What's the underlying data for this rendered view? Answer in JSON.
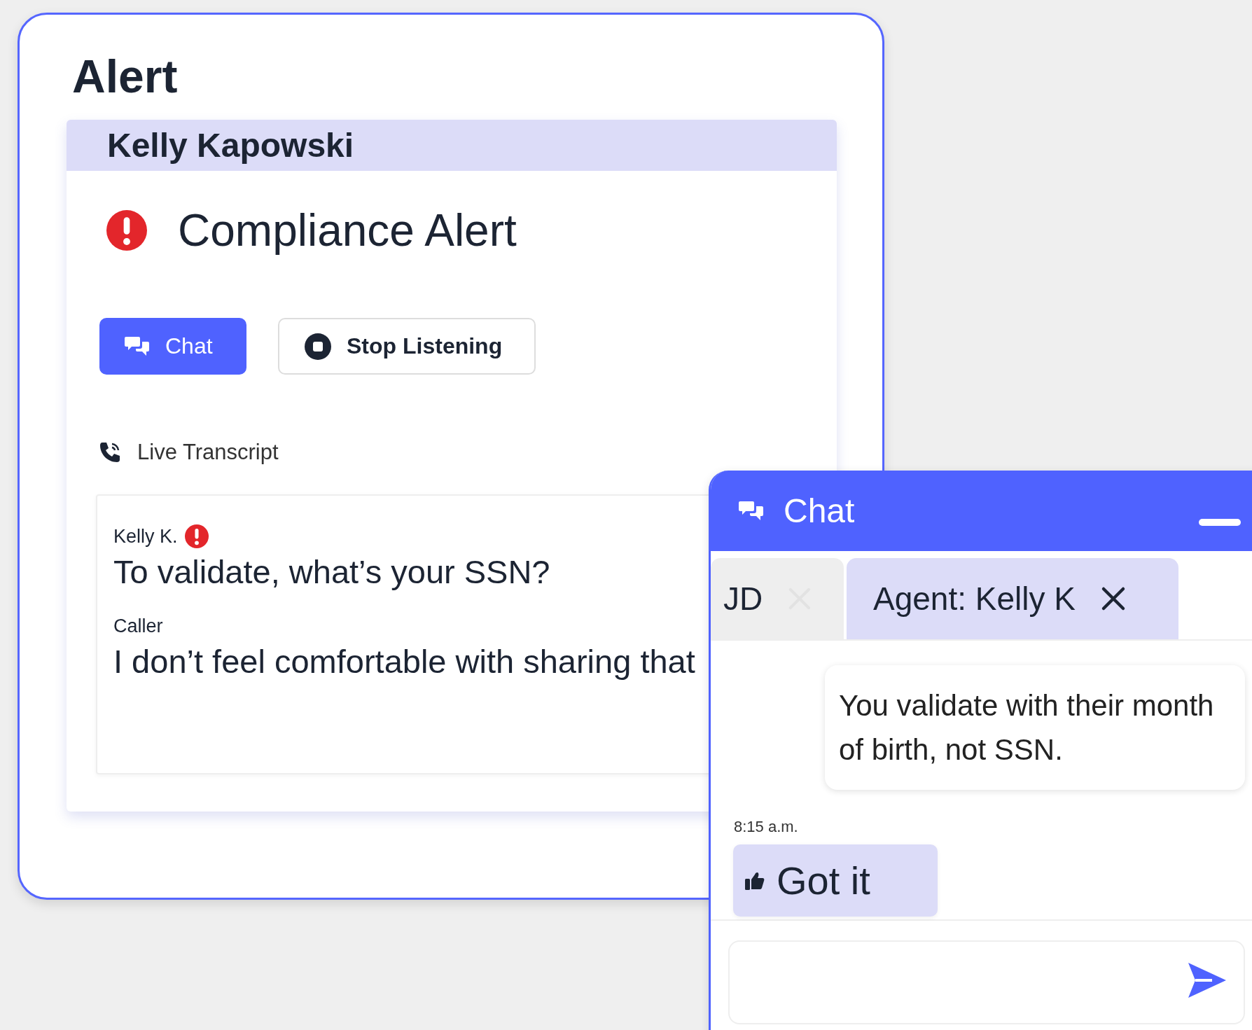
{
  "alert": {
    "title": "Alert",
    "contact": "Kelly Kapowski",
    "alert_title": "Compliance Alert",
    "buttons": [
      {
        "kind": "primary",
        "label": "Chat"
      },
      {
        "kind": "secondary",
        "label": "Stop Listening"
      }
    ],
    "transcript_label": "Live Transcript",
    "transcript": [
      {
        "speaker": "Kelly K.",
        "flagged": true,
        "text": "To validate, what’s your SSN?"
      },
      {
        "speaker": "Caller",
        "flagged": false,
        "text": "I don’t feel comfortable with sharing that"
      }
    ]
  },
  "chat": {
    "title": "Chat",
    "tabs": [
      {
        "label": "JD",
        "selected": false
      },
      {
        "label": "Agent: Kelly K",
        "selected": true
      }
    ],
    "messages": [
      {
        "kind": "incoming",
        "text": "You validate with their month of birth, not SSN."
      },
      {
        "kind": "outgoing",
        "time": "8:15 a.m.",
        "text": "Got it"
      }
    ]
  }
}
